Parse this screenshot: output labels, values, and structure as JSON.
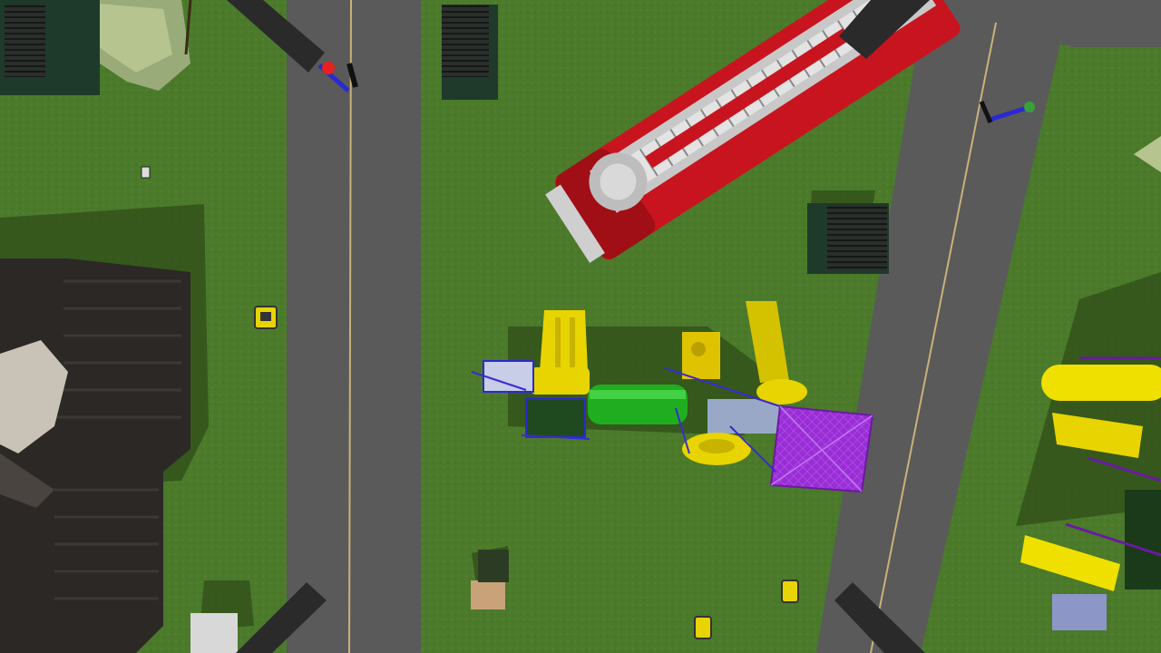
{
  "scene": {
    "view": "top-down",
    "description_layers": [
      "grass",
      "roads",
      "buildings",
      "playground",
      "vehicles",
      "people",
      "rotor-blades"
    ],
    "colors": {
      "grass": "#4b7a2b",
      "grass_dark": "#3f6a22",
      "road": "#5a5a5a",
      "road_line": "#c9b27a",
      "fire_truck": "#c8141e",
      "playground_yellow": "#e8d400",
      "playground_green": "#1fae1f",
      "playground_purple": "#9a2ed6",
      "dumpster": "#2e3a32",
      "house_roof": "#2b2826",
      "rotor": "#2a2a2a"
    },
    "objects": {
      "fire_truck": "fire-truck",
      "playground_main": "playground-structure",
      "playground_right": "playground-structure-right",
      "dumpsters": [
        "dumpster-top-left",
        "dumpster-top-center",
        "dumpster-right"
      ],
      "toy_cars": [
        "toy-car-left",
        "toy-car-bottom-1",
        "toy-car-bottom-2"
      ],
      "people": [
        "pedestrian-road-left",
        "pedestrian-road-right"
      ],
      "house": "house-left",
      "rotor_blades": [
        "rotor-top-left",
        "rotor-top-right",
        "rotor-bottom-left",
        "rotor-bottom-right"
      ]
    }
  }
}
